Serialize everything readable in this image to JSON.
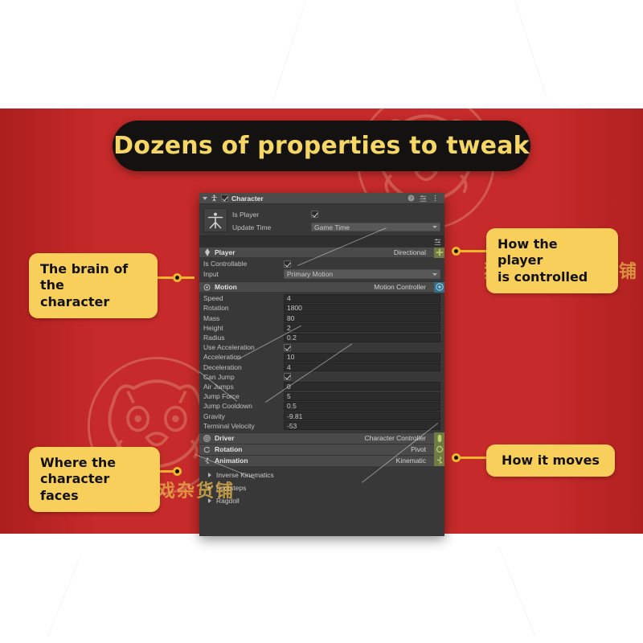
{
  "theme": {
    "band_color": "#c62a2a",
    "accent_yellow": "#f8cf5a",
    "title_text_color": "#f6d765",
    "title_pill_color": "#141210",
    "panel_bg": "#383838"
  },
  "title": {
    "text": "Dozens of properties to tweak"
  },
  "watermark": {
    "brand_text": "狸猫的游戏杂货铺",
    "logo_name": "raccoon-face-logo"
  },
  "callouts": [
    {
      "id": "brain",
      "lines": [
        "The brain of the",
        "character"
      ],
      "name": "callout-brain-of-the-character"
    },
    {
      "id": "controlled",
      "lines": [
        "How the player",
        "is controlled"
      ],
      "name": "callout-how-player-is-controlled"
    },
    {
      "id": "faces",
      "lines": [
        "Where the",
        "character faces"
      ],
      "name": "callout-where-character-faces"
    },
    {
      "id": "moves",
      "lines": [
        "How it moves"
      ],
      "name": "callout-how-it-moves"
    }
  ],
  "inspector": {
    "component_title": "Character",
    "component_enabled": true,
    "header_icons": [
      "help-icon",
      "preset-icon",
      "more-menu-icon"
    ],
    "avatar_icon": "character-avatar-icon",
    "top_rows": [
      {
        "label": "Is Player",
        "type": "checkbox",
        "value": true
      },
      {
        "label": "Update Time",
        "type": "dropdown",
        "value": "Game Time"
      }
    ],
    "sections": [
      {
        "name": "Player",
        "value": "Directional",
        "icon": "player-pin-icon",
        "badge": "move-tool-icon",
        "badge_color": "green",
        "rows": [
          {
            "label": "Is Controllable",
            "type": "checkbox",
            "value": true
          },
          {
            "label": "Input",
            "type": "dropdown",
            "value": "Primary Motion"
          }
        ]
      },
      {
        "name": "Motion",
        "value": "Motion Controller",
        "icon": "motion-gear-icon",
        "badge": "motion-controller-icon",
        "badge_color": "blue",
        "properties": [
          {
            "label": "Speed",
            "type": "number",
            "value": "4"
          },
          {
            "label": "Rotation",
            "type": "number",
            "value": "1800"
          },
          {
            "label": "Mass",
            "type": "number",
            "value": "80"
          },
          {
            "label": "Height",
            "type": "number",
            "value": "2"
          },
          {
            "label": "Radius",
            "type": "number",
            "value": "0.2"
          },
          {
            "label": "Use Acceleration",
            "type": "checkbox",
            "value": true
          },
          {
            "label": "Acceleration",
            "type": "number",
            "value": "10"
          },
          {
            "label": "Deceleration",
            "type": "number",
            "value": "4"
          },
          {
            "label": "Can Jump",
            "type": "checkbox",
            "value": true
          },
          {
            "label": "Air Jumps",
            "type": "number",
            "value": "0"
          },
          {
            "label": "Jump Force",
            "type": "number",
            "value": "5"
          },
          {
            "label": "Jump Cooldown",
            "type": "number",
            "value": "0.5"
          },
          {
            "label": "Gravity",
            "type": "number",
            "value": "-9.81"
          },
          {
            "label": "Terminal Velocity",
            "type": "number",
            "value": "-53"
          }
        ]
      },
      {
        "name": "Driver",
        "value": "Character Controller",
        "icon": "driver-icon",
        "badge": "capsule-icon",
        "badge_color": "green"
      },
      {
        "name": "Rotation",
        "value": "Pivot",
        "icon": "rotation-icon",
        "badge": "rotate-icon",
        "badge_color": "green"
      },
      {
        "name": "Animation",
        "value": "Kinematic",
        "icon": "animation-icon",
        "badge": "running-icon",
        "badge_color": "green"
      }
    ],
    "foldouts": [
      {
        "label": "Inverse Kinematics"
      },
      {
        "label": "Footsteps"
      },
      {
        "label": "Ragdoll"
      }
    ]
  }
}
